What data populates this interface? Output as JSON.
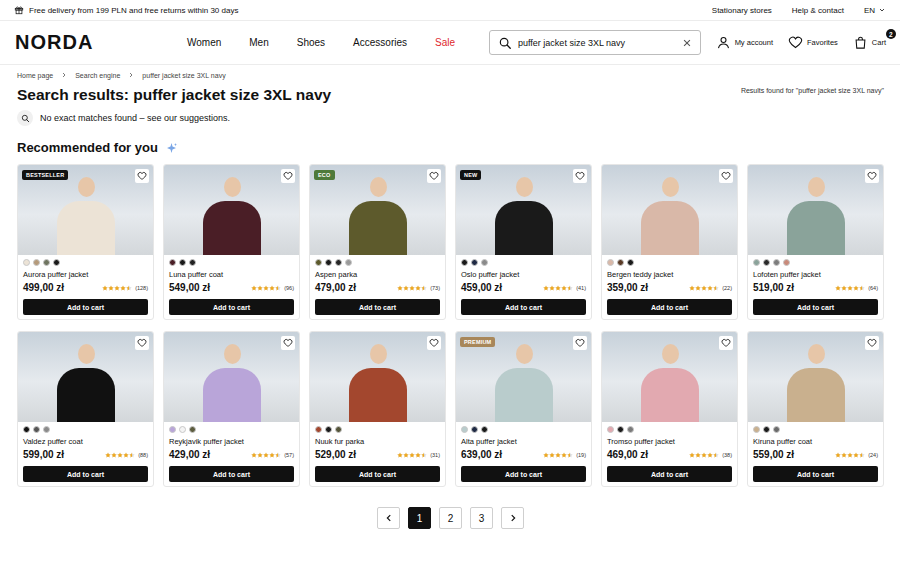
{
  "top_bar": {
    "promo": "Free delivery from 199 PLN and free returns within 30 days",
    "links": [
      "Stationary stores",
      "Help & contact"
    ],
    "language": "EN"
  },
  "header": {
    "logo": "NORDA",
    "nav": [
      {
        "label": "Women",
        "sale": false
      },
      {
        "label": "Men",
        "sale": false
      },
      {
        "label": "Shoes",
        "sale": false
      },
      {
        "label": "Accessories",
        "sale": false
      },
      {
        "label": "Sale",
        "sale": true
      }
    ],
    "search": {
      "value": "puffer jacket size 3XL navy"
    },
    "actions": [
      {
        "label": "My account",
        "kind": "account"
      },
      {
        "label": "Favorites",
        "kind": "favorites"
      },
      {
        "label": "Cart",
        "kind": "cart",
        "badge": "2"
      }
    ]
  },
  "breadcrumb": [
    "Home page",
    "Search engine",
    "puffer jacket size 3XL navy"
  ],
  "results": {
    "title": "Search results: puffer jacket size 3XL navy",
    "found": "Results found for \"puffer jacket size 3XL navy\"",
    "notice": "No exact matches found – see our suggestions."
  },
  "recommended": {
    "title": "Recommended for you",
    "products": [
      {
        "name": "Aurora puffer jacket",
        "price": "499,00 zł",
        "reviews": "(128)",
        "stars": 4.5,
        "badge": {
          "text": "BESTSELLER",
          "color": "#111111"
        },
        "swatches": [
          "#ece3d6",
          "#b59a7a",
          "#6f7560",
          "#1a1a1a"
        ],
        "favorite": false,
        "button": "Add to cart"
      },
      {
        "name": "Luna puffer coat",
        "price": "549,00 zł",
        "reviews": "(96)",
        "stars": 4.5,
        "swatches": [
          "#4a1e26",
          "#1a1a1a",
          "#222222"
        ],
        "favorite": false,
        "button": "Add to cart"
      },
      {
        "name": "Aspen parka",
        "price": "479,00 zł",
        "reviews": "(73)",
        "stars": 4.5,
        "badge": {
          "text": "ECO",
          "color": "#4f7a3a"
        },
        "swatches": [
          "#5d5a2c",
          "#1a1a1a",
          "#262626",
          "#9a9a9a"
        ],
        "favorite": false,
        "button": "Add to cart"
      },
      {
        "name": "Oslo puffer jacket",
        "price": "459,00 zł",
        "reviews": "(41)",
        "stars": 4.5,
        "badge": {
          "text": "NEW",
          "color": "#111111"
        },
        "swatches": [
          "#1a1a1a",
          "#1f2a44",
          "#8a8a8a"
        ],
        "favorite": false,
        "button": "Add to cart"
      },
      {
        "name": "Bergen teddy jacket",
        "price": "359,00 zł",
        "reviews": "(22)",
        "stars": 4.5,
        "swatches": [
          "#d9b8a8",
          "#5a3a26",
          "#1a1a1a"
        ],
        "favorite": false,
        "button": "Add to cart"
      },
      {
        "name": "Lofoten puffer jacket",
        "price": "519,00 zł",
        "reviews": "(64)",
        "stars": 4.5,
        "swatches": [
          "#8aa39a",
          "#2a2a2a",
          "#7d7d7d",
          "#c98a7a"
        ],
        "favorite": false,
        "button": "Add to cart"
      },
      {
        "name": "Valdez puffer coat",
        "price": "599,00 zł",
        "reviews": "(88)",
        "stars": 4.5,
        "swatches": [
          "#111111",
          "#555555",
          "#8a8a8a"
        ],
        "favorite": false,
        "button": "Add to cart"
      },
      {
        "name": "Reykjavik puffer jacket",
        "price": "429,00 zł",
        "reviews": "(57)",
        "stars": 4.5,
        "swatches": [
          "#b9a5d9",
          "#f4f4f4",
          "#5c5c3e"
        ],
        "favorite": false,
        "button": "Add to cart"
      },
      {
        "name": "Nuuk fur parka",
        "price": "529,00 zł",
        "reviews": "(31)",
        "stars": 4.5,
        "swatches": [
          "#a3472e",
          "#1a1a1a",
          "#55553a"
        ],
        "favorite": false,
        "button": "Add to cart"
      },
      {
        "name": "Alta puffer jacket",
        "price": "639,00 zł",
        "reviews": "(19)",
        "stars": 4.5,
        "badge": {
          "text": "PREMIUM",
          "color": "#a8875a"
        },
        "swatches": [
          "#b9cccc",
          "#1f2a44",
          "#1a1a1a"
        ],
        "favorite": false,
        "button": "Add to cart"
      },
      {
        "name": "Tromso puffer jacket",
        "price": "469,00 zł",
        "reviews": "(38)",
        "stars": 4.5,
        "swatches": [
          "#e2a9b0",
          "#1a1a1a",
          "#7a7a7a"
        ],
        "favorite": false,
        "button": "Add to cart"
      },
      {
        "name": "Kiruna puffer coat",
        "price": "559,00 zł",
        "reviews": "(24)",
        "stars": 4.5,
        "swatches": [
          "#c9b08e",
          "#1a1a1a",
          "#6a6a6a"
        ],
        "favorite": false,
        "button": "Add to cart"
      }
    ]
  },
  "pagination": {
    "pages": [
      {
        "label": "1",
        "selected": true
      },
      {
        "label": "2",
        "selected": false
      },
      {
        "label": "3",
        "selected": false
      }
    ]
  }
}
